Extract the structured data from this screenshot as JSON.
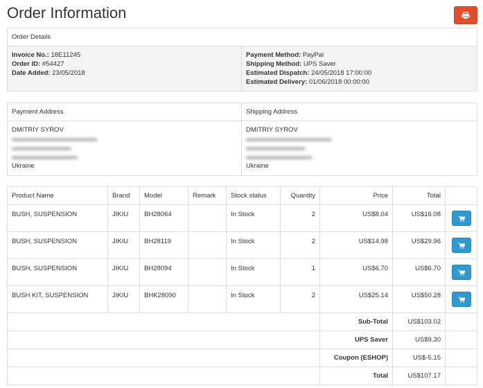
{
  "page": {
    "title": "Order Information"
  },
  "order_details": {
    "header": "Order Details",
    "invoice_label": "Invoice No.:",
    "invoice_value": "18E11245",
    "order_id_label": "Order ID:",
    "order_id_value": "#54427",
    "date_added_label": "Date Added:",
    "date_added_value": "23/05/2018",
    "payment_method_label": "Payment Method:",
    "payment_method_value": "PayPal",
    "shipping_method_label": "Shipping Method:",
    "shipping_method_value": "UPS Saver",
    "dispatch_label": "Estimated Dispatch:",
    "dispatch_value": "24/05/2018 17:00:00",
    "delivery_label": "Estimated Delivery:",
    "delivery_value": "01/06/2018 00:00:00"
  },
  "addresses": {
    "payment_header": "Payment Address",
    "shipping_header": "Shipping Address",
    "payment": {
      "name": "DMITRIY SYROV",
      "country": "Ukraine"
    },
    "shipping": {
      "name": "DMITRIY SYROV",
      "country": "Ukraine"
    }
  },
  "products": {
    "columns": {
      "name": "Product Name",
      "brand": "Brand",
      "model": "Model",
      "remark": "Remark",
      "stock": "Stock status",
      "quantity": "Quantity",
      "price": "Price",
      "total": "Total"
    },
    "rows": [
      {
        "name": "BUSH, SUSPENSION",
        "brand": "JIKIU",
        "model": "BH28064",
        "remark": "",
        "stock": "In Stock",
        "quantity": "2",
        "price": "US$8.04",
        "total": "US$16.08"
      },
      {
        "name": "BUSH, SUSPENSION",
        "brand": "JIKIU",
        "model": "BH28119",
        "remark": "",
        "stock": "In Stock",
        "quantity": "2",
        "price": "US$14.98",
        "total": "US$29.96"
      },
      {
        "name": "BUSH, SUSPENSION",
        "brand": "JIKIU",
        "model": "BH28094",
        "remark": "",
        "stock": "In Stock",
        "quantity": "1",
        "price": "US$6.70",
        "total": "US$6.70"
      },
      {
        "name": "BUSH KIT, SUSPENSION",
        "brand": "JIKIU",
        "model": "BHK28090",
        "remark": "",
        "stock": "In Stock",
        "quantity": "2",
        "price": "US$25.14",
        "total": "US$50.28"
      }
    ]
  },
  "totals": [
    {
      "label": "Sub-Total",
      "value": "US$103.02"
    },
    {
      "label": "UPS Saver",
      "value": "US$9.30"
    },
    {
      "label": "Coupon (ESHOP)",
      "value": "US$-5.15"
    },
    {
      "label": "Total",
      "value": "US$107.17"
    }
  ],
  "icons": {
    "print": "print-icon",
    "cart": "shopping-cart-icon"
  },
  "colors": {
    "print_button": "#e24d2e",
    "cart_button": "#2e9ad0",
    "header_bg": "#f4f4f4"
  }
}
